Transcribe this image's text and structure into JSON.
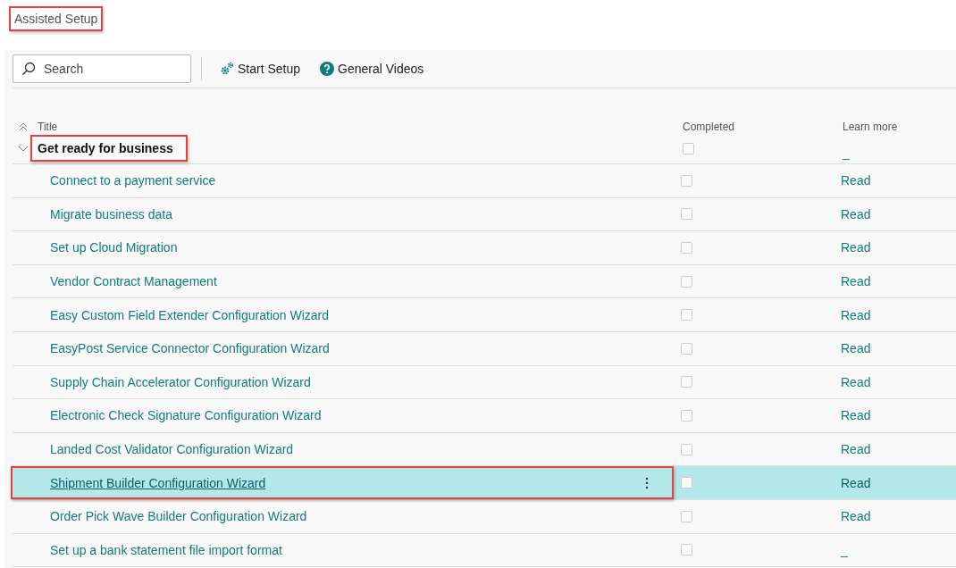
{
  "page_title": {
    "text": "Assisted Setup",
    "annotated": true
  },
  "search": {
    "placeholder": "Search"
  },
  "actions": [
    {
      "label": "Start Setup",
      "kind": "setup"
    },
    {
      "label": "General Videos",
      "kind": "help"
    }
  ],
  "table": {
    "columns": [
      "Title",
      "Completed",
      "Learn more"
    ],
    "group": {
      "title": "Get ready for business",
      "expanded": true,
      "annotated": true,
      "completed": false,
      "learn_more": "_"
    },
    "rows": [
      {
        "title": "Connect to a payment service",
        "completed": false,
        "learn_more": "Read",
        "selected": false,
        "annotated": false
      },
      {
        "title": "Migrate business data",
        "completed": false,
        "learn_more": "Read",
        "selected": false,
        "annotated": false
      },
      {
        "title": "Set up Cloud Migration",
        "completed": false,
        "learn_more": "Read",
        "selected": false,
        "annotated": false
      },
      {
        "title": "Vendor Contract Management",
        "completed": false,
        "learn_more": "Read",
        "selected": false,
        "annotated": false
      },
      {
        "title": "Easy Custom Field Extender Configuration Wizard",
        "completed": false,
        "learn_more": "Read",
        "selected": false,
        "annotated": false
      },
      {
        "title": "EasyPost Service Connector Configuration Wizard",
        "completed": false,
        "learn_more": "Read",
        "selected": false,
        "annotated": false
      },
      {
        "title": "Supply Chain Accelerator Configuration Wizard",
        "completed": false,
        "learn_more": "Read",
        "selected": false,
        "annotated": false
      },
      {
        "title": "Electronic Check Signature Configuration Wizard",
        "completed": false,
        "learn_more": "Read",
        "selected": false,
        "annotated": false
      },
      {
        "title": "Landed Cost Validator Configuration Wizard",
        "completed": false,
        "learn_more": "Read",
        "selected": false,
        "annotated": false
      },
      {
        "title": "Shipment Builder Configuration Wizard",
        "completed": false,
        "learn_more": "Read",
        "selected": true,
        "annotated": true
      },
      {
        "title": "Order Pick Wave Builder Configuration Wizard",
        "completed": false,
        "learn_more": "Read",
        "selected": false,
        "annotated": false
      },
      {
        "title": "Set up a bank statement file import format",
        "completed": false,
        "learn_more": "_",
        "selected": false,
        "annotated": false
      }
    ]
  }
}
